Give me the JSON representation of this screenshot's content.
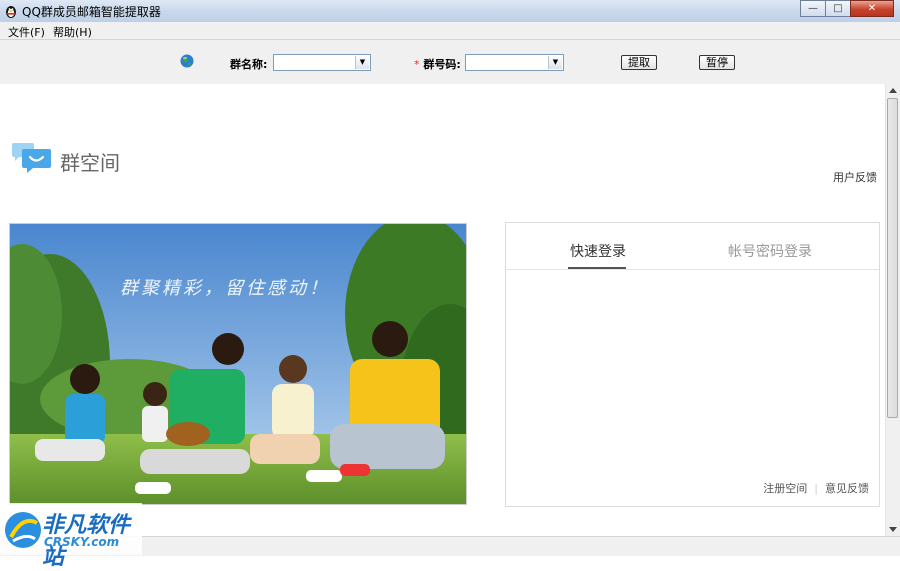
{
  "window": {
    "title": "QQ群成员邮箱智能提取器"
  },
  "menu": [
    {
      "label": "文件(F)"
    },
    {
      "label": "帮助(H)"
    }
  ],
  "toolbar": {
    "group_name_label": "群名称:",
    "required_mark": "*",
    "group_number_label": "群号码:",
    "group_name_value": "",
    "group_number_value": "",
    "extract_button": "提取",
    "pause_button": "暂停"
  },
  "page": {
    "logo_text": "群空间",
    "feedback_link": "用户反馈",
    "slogan": "群聚精彩，留住感动！",
    "login": {
      "tab_quick": "快速登录",
      "tab_password": "帐号密码登录",
      "register_link": "注册空间",
      "feedback_link": "意见反馈"
    }
  },
  "watermark": {
    "cn": "非凡软件站",
    "en": "CRSKY.com"
  },
  "colors": {
    "accent": "#1a6cc0",
    "close_button": "#c7432b",
    "sky": "#6fa0d8",
    "grass": "#7aa640"
  }
}
